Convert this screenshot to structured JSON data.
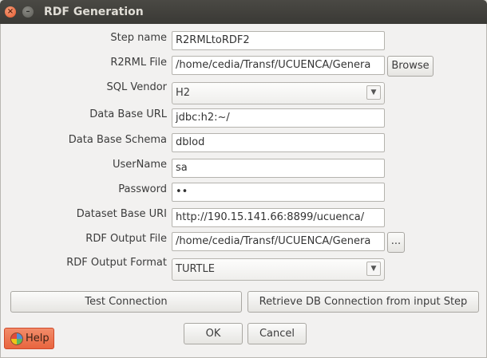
{
  "window": {
    "title": "RDF Generation"
  },
  "form": {
    "step_name_label": "Step name",
    "step_name_value": "R2RMLtoRDF2",
    "r2rml_file_label": "R2RML File",
    "r2rml_file_value": "/home/cedia/Transf/UCUENCA/Genera",
    "browse_label": "Browse",
    "sql_vendor_label": "SQL Vendor",
    "sql_vendor_value": "H2",
    "db_url_label": "Data Base URL",
    "db_url_value": "jdbc:h2:~/",
    "db_schema_label": "Data Base Schema",
    "db_schema_value": "dblod",
    "username_label": "UserName",
    "username_value": "sa",
    "password_label": "Password",
    "password_value": "••",
    "dataset_uri_label": "Dataset Base URI",
    "dataset_uri_value": "http://190.15.141.66:8899/ucuenca/",
    "output_file_label": "RDF Output File",
    "output_file_value": "/home/cedia/Transf/UCUENCA/Genera",
    "output_file_browse": "...",
    "output_format_label": "RDF Output Format",
    "output_format_value": "TURTLE"
  },
  "actions": {
    "test_connection": "Test Connection",
    "retrieve_db": "Retrieve DB Connection from input Step",
    "ok": "OK",
    "cancel": "Cancel",
    "help": "Help"
  }
}
